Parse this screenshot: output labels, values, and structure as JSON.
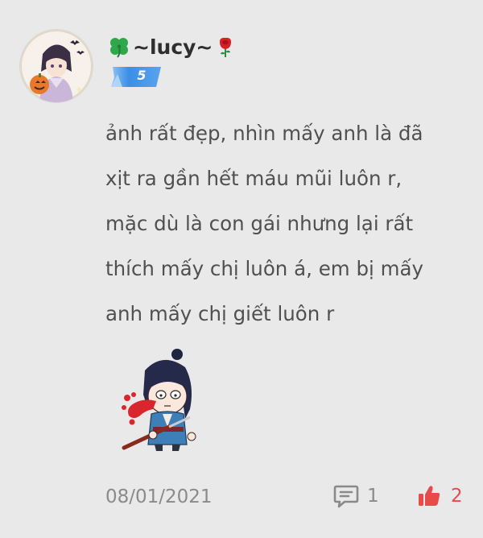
{
  "comment": {
    "username_prefix_icon": "four-leaf-clover-icon",
    "username": "~lucy~",
    "username_suffix_icon": "rose-icon",
    "level": "5",
    "text_lines": [
      "ảnh rất đẹp, nhìn mấy anh là đã",
      "xịt ra gần hết máu mũi luôn r,",
      "mặc dù là con gái nhưng lại rất",
      "thích mấy chị luôn á, em bị mấy",
      "anh mấy chị giết luôn r"
    ],
    "sticker": "nosebleed-chibi-sticker",
    "date": "08/01/2021",
    "reply_count": "1",
    "like_count": "2"
  },
  "colors": {
    "background": "#e9e9e9",
    "username": "#2f2f2f",
    "text": "#505050",
    "meta": "#8a8a8a",
    "level_badge": "#3b8fe6",
    "like": "#e84a4a"
  }
}
